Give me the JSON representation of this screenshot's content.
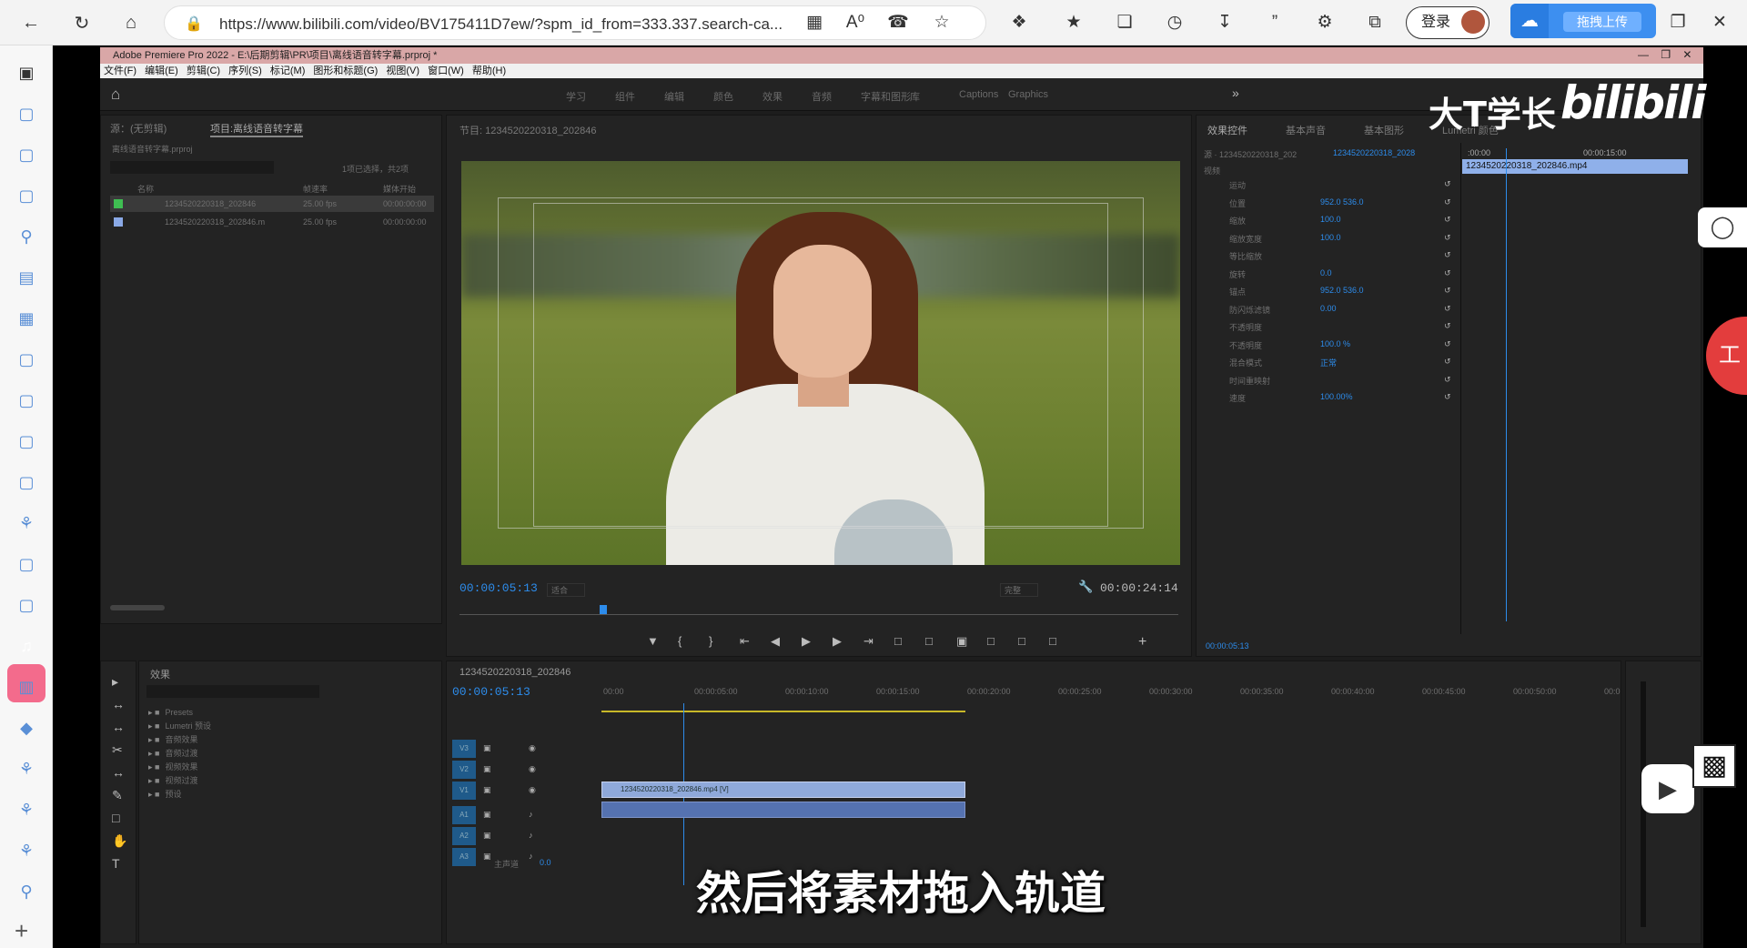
{
  "browser": {
    "url": "https://www.bilibili.com/video/BV175411D7ew/?spm_id_from=333.337.search-ca...",
    "login_label": "登录",
    "upload_label": "拖拽上传"
  },
  "sidebar": {
    "icons": [
      "tabs-icon",
      "bilibili-tv-icon",
      "bilibili-tv-icon",
      "bilibili-tv-icon",
      "search-icon",
      "document-icon",
      "apps-icon",
      "bilibili-tv-icon",
      "bilibili-tv-icon",
      "bilibili-tv-icon",
      "bilibili-tv-icon",
      "baidu-paw-icon",
      "bilibili-tv-icon",
      "bilibili-tv-icon",
      "speaker-icon",
      "book-icon",
      "diamond-icon",
      "baidu-paw-icon",
      "baidu-paw-icon",
      "baidu-paw-icon",
      "search-icon"
    ]
  },
  "premiere": {
    "title": "Adobe Premiere Pro 2022 - E:\\后期剪辑\\PR\\项目\\离线语音转字幕.prproj *",
    "menu": "文件(F) 编辑(E) 剪辑(C) 序列(S) 标记(M) 图形和标题(G) 视图(V) 窗口(W) 帮助(H)",
    "workspace_tabs": [
      "学习",
      "组件",
      "编辑",
      "颜色",
      "效果",
      "音频",
      "字幕和图形",
      "库",
      "Captions",
      "Graphics"
    ],
    "project_panel": {
      "tab_inactive": "源：(无剪辑)",
      "tab_active": "项目:离线语音转字幕",
      "path": "离线语音转字幕.prproj",
      "selected_count": "1项已选择，共2项",
      "columns": [
        "名称",
        "帧速率",
        "媒体开始"
      ],
      "items": [
        {
          "name": "1234520220318_202846",
          "fps": "25.00 fps",
          "start": "00:00:00:00",
          "color": "#3fbe52"
        },
        {
          "name": "1234520220318_202846.m",
          "fps": "25.00 fps",
          "start": "00:00:00:00",
          "color": "#8aa9e6"
        }
      ]
    },
    "program_monitor": {
      "title": "节目: 1234520220318_202846",
      "timecode_current": "00:00:05:13",
      "fit_label": "适合",
      "quality_label": "完整",
      "timecode_duration": "00:00:24:14",
      "playhead_fraction": 0.2
    },
    "effect_controls": {
      "tabs": [
        "效果控件",
        "基本声音",
        "基本图形",
        "Lumetri 颜色"
      ],
      "master": "源 · 1234520220318_202",
      "sequence": "1234520220318_2028",
      "clip_name": "1234520220318_202846.mp4",
      "ruler_start": ":00:00",
      "ruler_end": "00:00:15:00",
      "section_video": "视频",
      "rows": [
        {
          "label": "运动",
          "value": ""
        },
        {
          "label": "位置",
          "value": "952.0   536.0"
        },
        {
          "label": "缩放",
          "value": "100.0"
        },
        {
          "label": "缩放宽度",
          "value": "100.0"
        },
        {
          "label": "等比缩放",
          "value": ""
        },
        {
          "label": "旋转",
          "value": "0.0"
        },
        {
          "label": "锚点",
          "value": "952.0   536.0"
        },
        {
          "label": "防闪烁滤镜",
          "value": "0.00"
        },
        {
          "label": "不透明度",
          "value": ""
        },
        {
          "label": "不透明度",
          "value": "100.0 %"
        },
        {
          "label": "混合模式",
          "value": "正常"
        },
        {
          "label": "时间重映射",
          "value": ""
        },
        {
          "label": "速度",
          "value": "100.00%"
        }
      ],
      "bottom_timecode": "00:00:05:13"
    },
    "effects_panel": {
      "title": "效果",
      "folders": [
        "Presets",
        "Lumetri 预设",
        "音频效果",
        "音频过渡",
        "视频效果",
        "视频过渡",
        "预设"
      ]
    },
    "timeline": {
      "title": "1234520220318_202846",
      "timecode": "00:00:05:13",
      "ruler": [
        "00:00",
        "00:00:05:00",
        "00:00:10:00",
        "00:00:15:00",
        "00:00:20:00",
        "00:00:25:00",
        "00:00:30:00",
        "00:00:35:00",
        "00:00:40:00",
        "00:00:45:00",
        "00:00:50:00",
        "00:0"
      ],
      "video_tracks": [
        "V3",
        "V2",
        "V1"
      ],
      "audio_tracks": [
        "A1",
        "A2",
        "A3"
      ],
      "master_label": "主声道",
      "master_value": "0.0",
      "video_clip": "1234520220318_202846.mp4 [V]"
    }
  },
  "overlay": {
    "subtitle": "然后将素材拖入轨道",
    "logo_text": "大T学长",
    "bili_logo": "bilibili"
  }
}
